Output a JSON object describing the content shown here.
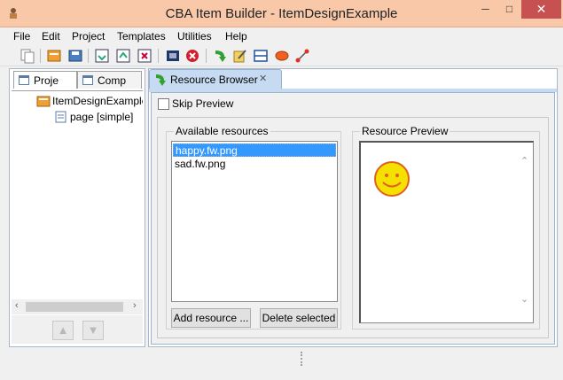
{
  "window": {
    "title": "CBA Item Builder - ItemDesignExample",
    "minimize": "─",
    "maximize": "□",
    "close": "✕"
  },
  "menu": {
    "items": [
      "File",
      "Edit",
      "Project",
      "Templates",
      "Utilities",
      "Help"
    ]
  },
  "toolbar": {
    "icons": [
      "new-copy-icon",
      "open-project-icon",
      "save-project-icon",
      "import-icon",
      "export-icon",
      "delete-icon",
      "preview-icon",
      "stop-icon",
      "run-icon",
      "edit-icon",
      "layout-icon",
      "ellipse-icon",
      "link-icon"
    ]
  },
  "left_panel": {
    "tabs": [
      {
        "label": "Proje",
        "active": true
      },
      {
        "label": "Comp",
        "active": false
      }
    ],
    "tree": {
      "root": "ItemDesignExample",
      "children": [
        "page [simple]"
      ]
    },
    "scroll_left": "‹",
    "scroll_right": "›",
    "nav_up": "▲",
    "nav_down": "▼"
  },
  "editor": {
    "tab_label": "Resource Browser",
    "tab_close": "✕",
    "skip_preview_label": "Skip Preview",
    "skip_preview_checked": false,
    "available_resources": {
      "legend": "Available resources",
      "items": [
        "happy.fw.png",
        "sad.fw.png"
      ],
      "selected_index": 0
    },
    "add_resource_label": "Add resource ...",
    "delete_selected_label": "Delete selected",
    "resource_preview": {
      "legend": "Resource Preview",
      "scroll_up": "⌃",
      "scroll_down": "⌄",
      "image": "smiley-face",
      "colors": {
        "face_fill": "#f5e000",
        "face_stroke": "#e06020"
      }
    }
  },
  "colors": {
    "titlebar": "#f8c8a8",
    "selection": "#3399ff",
    "close_button": "#c75050",
    "tab_active": "#c6dbf1"
  }
}
